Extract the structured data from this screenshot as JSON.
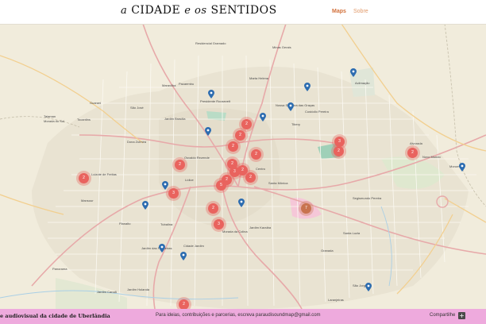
{
  "header": {
    "logo": {
      "a": "a",
      "cidade": "CIDADE",
      "e": "e os",
      "sentidos": "SENTIDOS"
    },
    "nav": [
      {
        "label": "Maps",
        "active": true
      },
      {
        "label": "Sobre",
        "active": false
      }
    ]
  },
  "map": {
    "neighborhoods": [
      "Residencial Gramado",
      "Minas Gerais",
      "Marta Helena",
      "Maravilha",
      "Pacaembu",
      "Presidente Roosevelt",
      "Jardim Brasília",
      "São José",
      "Nossa Senhora das Graças",
      "Custódio Pereira",
      "Tibery",
      "Aclimação",
      "Guarani",
      "Taiaman",
      "Morada do Sol",
      "Tocantins",
      "Dona Zulmira",
      "Osvaldo Rezende",
      "Centro",
      "Lídice",
      "Luizote de Freitas",
      "Mansour",
      "Planalto",
      "Tubalina",
      "Cidade Jardim",
      "Jardim das Palmeiras",
      "Morada da Colina",
      "Jardim Karaíba",
      "Santa Mônica",
      "Segismundo Pereira",
      "Santa Luzia",
      "Granada",
      "Panorama",
      "Jardim Canaã",
      "Jardim Holanda",
      "Laranjeiras",
      "São Jorge",
      "Morumbi",
      "Alvorada",
      "Novo Mundo"
    ],
    "pins": [
      "location-pin-1",
      "location-pin-2",
      "location-pin-3",
      "location-pin-4",
      "location-pin-5",
      "location-pin-6",
      "location-pin-7",
      "location-pin-8",
      "location-pin-9",
      "location-pin-10",
      "location-pin-11",
      "location-pin-12",
      "location-pin-13"
    ],
    "clusters": [
      "2",
      "2",
      "2",
      "2",
      "2",
      "3",
      "2",
      "5",
      "2",
      "2",
      "3",
      "2",
      "3",
      "3",
      "2",
      "7",
      "2",
      "2",
      "2",
      "2"
    ]
  },
  "footer": {
    "title": "e audiovisual da cidade de Uberlândia",
    "contact": "Para ideias, contribuições e parcerias, escreva paraudisoundmap@gmail.com",
    "share": "Compartilhe",
    "share_icon": "+"
  },
  "colors": {
    "cluster": "#e9635e",
    "pin": "#2c6cb0",
    "footer": "#eeaadd",
    "nav": "#d2703a"
  }
}
